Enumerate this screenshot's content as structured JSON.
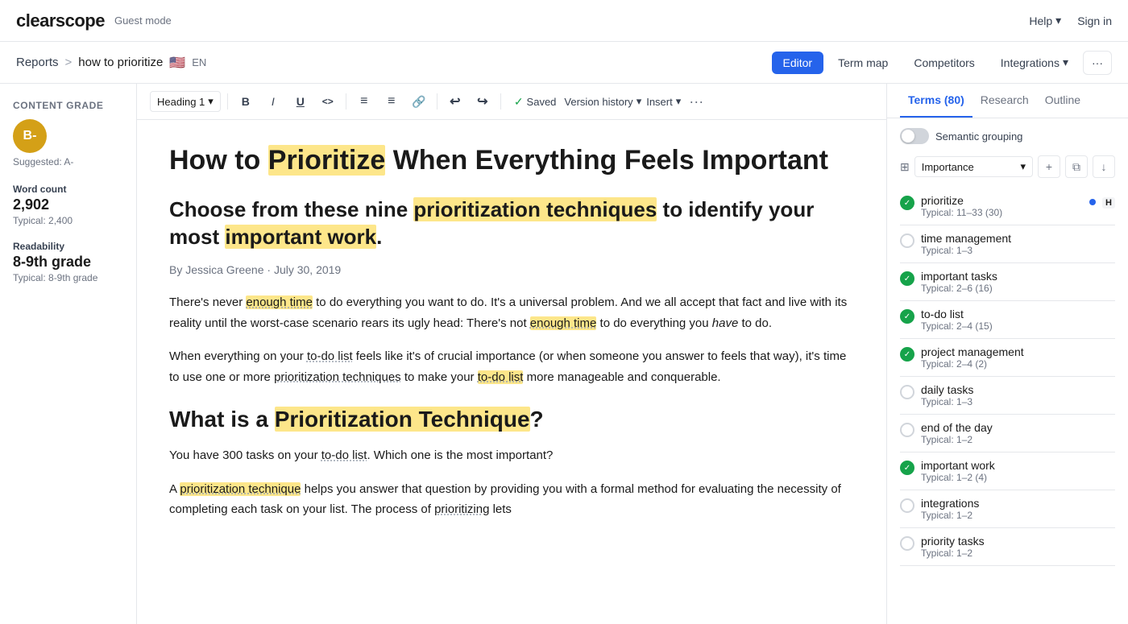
{
  "topnav": {
    "logo": "clearscope",
    "guest_mode": "Guest mode",
    "help_label": "Help",
    "sign_in_label": "Sign in"
  },
  "breadcrumb": {
    "reports_label": "Reports",
    "separator": ">",
    "title": "how to prioritize",
    "flag": "🇺🇸",
    "lang": "EN"
  },
  "nav_tabs": [
    {
      "label": "Editor",
      "active": true
    },
    {
      "label": "Term map",
      "active": false
    },
    {
      "label": "Competitors",
      "active": false
    },
    {
      "label": "Integrations",
      "active": false
    }
  ],
  "toolbar": {
    "heading_select": "Heading 1",
    "saved_label": "Saved",
    "version_history_label": "Version history",
    "insert_label": "Insert",
    "bold": "B",
    "italic": "I",
    "underline": "U",
    "code": "<>",
    "bullet_list": "≡",
    "ordered_list": "≡",
    "link": "🔗",
    "undo": "↩",
    "redo": "↪"
  },
  "left_sidebar": {
    "content_grade_label": "Content grade",
    "grade": "B-",
    "suggested_label": "Suggested: A-",
    "word_count_label": "Word count",
    "word_count_value": "2,902",
    "word_count_typical": "Typical: 2,400",
    "readability_label": "Readability",
    "readability_value": "8-9th grade",
    "readability_typical": "Typical: 8-9th grade"
  },
  "article": {
    "title_plain": "How to Prioritize When Everything Feels Important",
    "title_highlighted_word": "Prioritize",
    "h2_1": "Choose from these nine prioritization techniques to identify your most important work.",
    "byline": "By Jessica Greene · July 30, 2019",
    "p1": "There's never enough time to do everything you want to do. It's a universal problem. And we all accept that fact and live with its reality until the worst-case scenario rears its ugly head: There's not enough time to do everything you have to do.",
    "p2": "When everything on your to-do list feels like it's of crucial importance (or when someone you answer to feels that way), it's time to use one or more prioritization techniques to make your to-do list more manageable and conquerable.",
    "h3_1": "What is a Prioritization Technique?",
    "h3_1_highlighted": "Prioritization Technique",
    "p3": "You have 300 tasks on your to-do list. Which one is the most important?",
    "p4_start": "A prioritization technique helps you answer that question by providing you with a formal method for evaluating the necessity of completing each task on your list. The process of prioritizing lets"
  },
  "right_sidebar": {
    "tabs": [
      {
        "label": "Terms (80)",
        "active": true
      },
      {
        "label": "Research",
        "active": false
      },
      {
        "label": "Outline",
        "active": false
      }
    ],
    "semantic_grouping_label": "Semantic grouping",
    "sort_label": "Importance",
    "terms": [
      {
        "name": "prioritize",
        "typical": "Typical: 11–33 (30)",
        "checked": true,
        "has_dot": true,
        "has_h": true
      },
      {
        "name": "time management",
        "typical": "Typical: 1–3",
        "checked": false,
        "has_dot": false,
        "has_h": false
      },
      {
        "name": "important tasks",
        "typical": "Typical: 2–6 (16)",
        "checked": true,
        "has_dot": false,
        "has_h": false
      },
      {
        "name": "to-do list",
        "typical": "Typical: 2–4 (15)",
        "checked": true,
        "has_dot": false,
        "has_h": false
      },
      {
        "name": "project management",
        "typical": "Typical: 2–4 (2)",
        "checked": true,
        "has_dot": false,
        "has_h": false
      },
      {
        "name": "daily tasks",
        "typical": "Typical: 1–3",
        "checked": false,
        "has_dot": false,
        "has_h": false
      },
      {
        "name": "end of the day",
        "typical": "Typical: 1–2",
        "checked": false,
        "has_dot": false,
        "has_h": false
      },
      {
        "name": "important work",
        "typical": "Typical: 1–2 (4)",
        "checked": true,
        "has_dot": false,
        "has_h": false
      },
      {
        "name": "integrations",
        "typical": "Typical: 1–2",
        "checked": false,
        "has_dot": false,
        "has_h": false
      },
      {
        "name": "priority tasks",
        "typical": "Typical: 1–2",
        "checked": false,
        "has_dot": false,
        "has_h": false
      }
    ]
  }
}
